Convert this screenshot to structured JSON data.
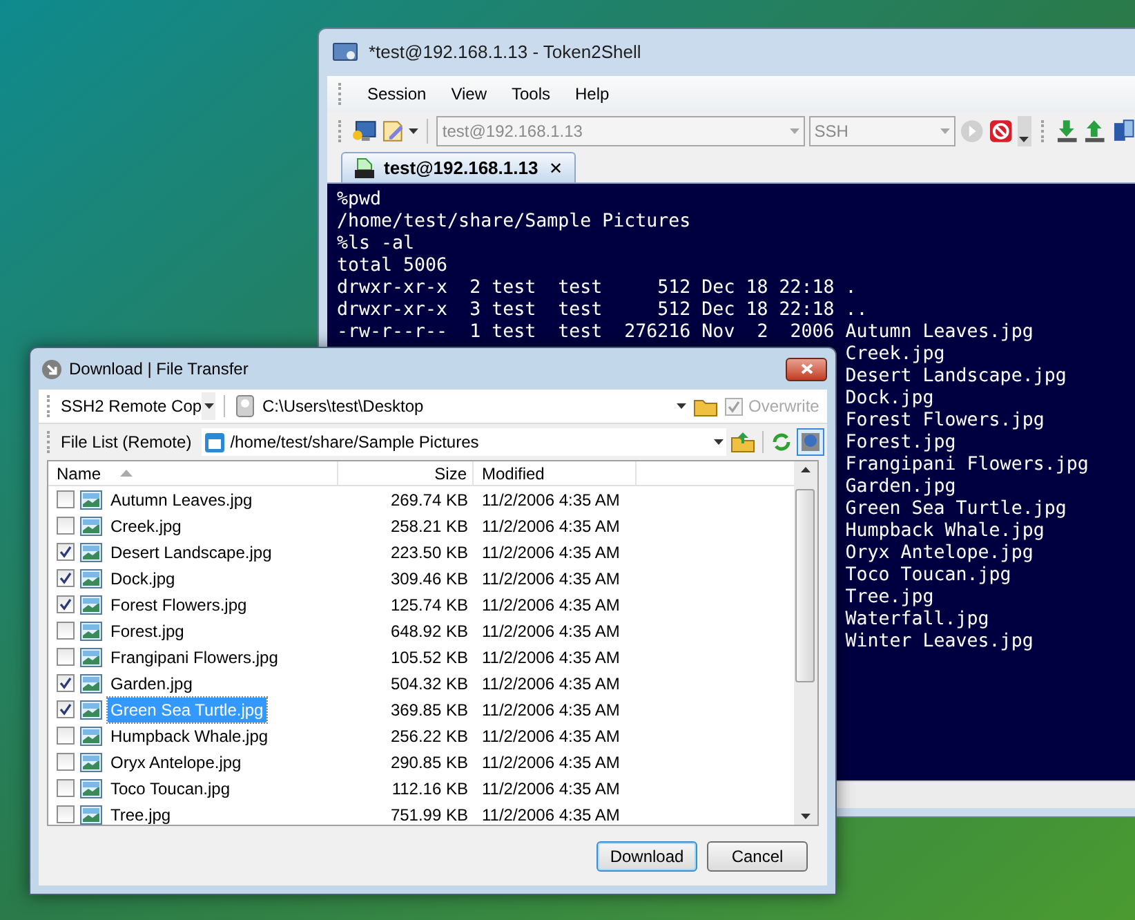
{
  "main_window": {
    "title": "*test@192.168.1.13 - Token2Shell",
    "menu": [
      "Session",
      "View",
      "Tools",
      "Help"
    ],
    "toolbar": {
      "host": "test@192.168.1.13",
      "protocol": "SSH"
    },
    "tabs": [
      {
        "label": "test@192.168.1.13",
        "selected": true,
        "close": "✕"
      }
    ],
    "terminal": {
      "lines": [
        "%pwd",
        "/home/test/share/Sample Pictures",
        "%ls -al",
        "total 5006",
        "drwxr-xr-x  2 test  test     512 Dec 18 22:18 .",
        "drwxr-xr-x  3 test  test     512 Dec 18 22:18 ..",
        "-rw-r--r--  1 test  test  276216 Nov  2  2006 Autumn Leaves.jpg"
      ],
      "listing_names": [
        "Creek.jpg",
        "Desert Landscape.jpg",
        "Dock.jpg",
        "Forest Flowers.jpg",
        "Forest.jpg",
        "Frangipani Flowers.jpg",
        "Garden.jpg",
        "Green Sea Turtle.jpg",
        "Humpback Whale.jpg",
        "Oryx Antelope.jpg",
        "Toco Toucan.jpg",
        "Tree.jpg",
        "Waterfall.jpg",
        "Winter Leaves.jpg"
      ]
    }
  },
  "dialog": {
    "title": "Download | File Transfer",
    "mode": "SSH2 Remote Cop",
    "local_path": "C:\\Users\\test\\Desktop",
    "overwrite": {
      "label": "Overwrite",
      "checked": true,
      "disabled": true
    },
    "list_label": "File List (Remote)",
    "remote_path": "/home/test/share/Sample Pictures",
    "columns": [
      "Name",
      "Size",
      "Modified"
    ],
    "rows": [
      {
        "name": "Autumn Leaves.jpg",
        "size": "269.74 KB",
        "modified": "11/2/2006 4:35 AM",
        "checked": false,
        "selected": false
      },
      {
        "name": "Creek.jpg",
        "size": "258.21 KB",
        "modified": "11/2/2006 4:35 AM",
        "checked": false,
        "selected": false
      },
      {
        "name": "Desert Landscape.jpg",
        "size": "223.50 KB",
        "modified": "11/2/2006 4:35 AM",
        "checked": true,
        "selected": false
      },
      {
        "name": "Dock.jpg",
        "size": "309.46 KB",
        "modified": "11/2/2006 4:35 AM",
        "checked": true,
        "selected": false
      },
      {
        "name": "Forest Flowers.jpg",
        "size": "125.74 KB",
        "modified": "11/2/2006 4:35 AM",
        "checked": true,
        "selected": false
      },
      {
        "name": "Forest.jpg",
        "size": "648.92 KB",
        "modified": "11/2/2006 4:35 AM",
        "checked": false,
        "selected": false
      },
      {
        "name": "Frangipani Flowers.jpg",
        "size": "105.52 KB",
        "modified": "11/2/2006 4:35 AM",
        "checked": false,
        "selected": false
      },
      {
        "name": "Garden.jpg",
        "size": "504.32 KB",
        "modified": "11/2/2006 4:35 AM",
        "checked": true,
        "selected": false
      },
      {
        "name": "Green Sea Turtle.jpg",
        "size": "369.85 KB",
        "modified": "11/2/2006 4:35 AM",
        "checked": true,
        "selected": true
      },
      {
        "name": "Humpback Whale.jpg",
        "size": "256.22 KB",
        "modified": "11/2/2006 4:35 AM",
        "checked": false,
        "selected": false
      },
      {
        "name": "Oryx Antelope.jpg",
        "size": "290.85 KB",
        "modified": "11/2/2006 4:35 AM",
        "checked": false,
        "selected": false
      },
      {
        "name": "Toco Toucan.jpg",
        "size": "112.16 KB",
        "modified": "11/2/2006 4:35 AM",
        "checked": false,
        "selected": false
      },
      {
        "name": "Tree.jpg",
        "size": "751.99 KB",
        "modified": "11/2/2006 4:35 AM",
        "checked": false,
        "selected": false
      }
    ],
    "buttons": [
      "Download",
      "Cancel"
    ]
  }
}
